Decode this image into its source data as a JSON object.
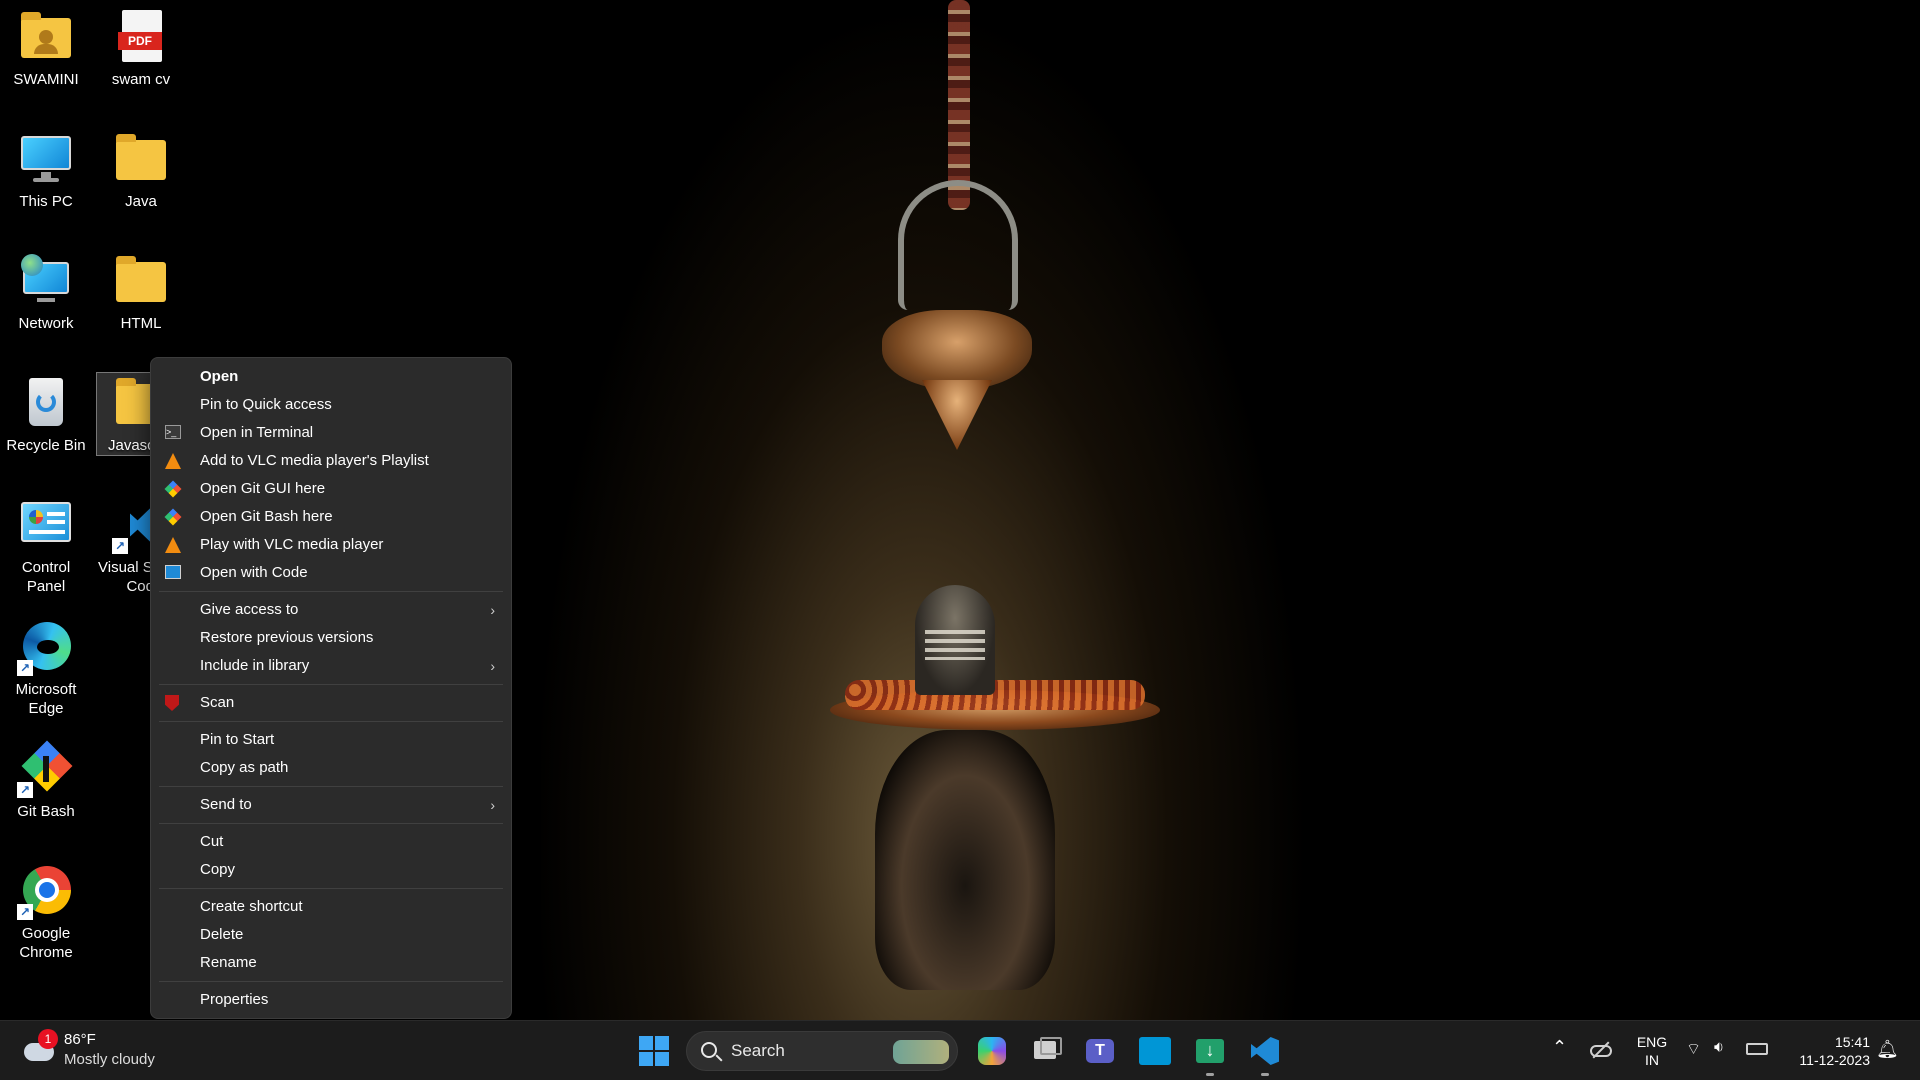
{
  "desktop_icons": [
    {
      "label": "SWAMINI",
      "icon": "user-folder-icon"
    },
    {
      "label": "swam cv",
      "icon": "pdf-file-icon",
      "badge": "PDF"
    },
    {
      "label": "This PC",
      "icon": "monitor-icon"
    },
    {
      "label": "Java",
      "icon": "folder-icon"
    },
    {
      "label": "Network",
      "icon": "network-icon"
    },
    {
      "label": "HTML",
      "icon": "folder-icon"
    },
    {
      "label": "Recycle Bin",
      "icon": "recycle-bin-icon"
    },
    {
      "label": "Javasc",
      "icon": "folder-icon"
    },
    {
      "label": "Control Panel",
      "icon": "control-panel-icon"
    },
    {
      "label": "Visual S",
      "label2": "Cod",
      "icon": "vscode-icon"
    },
    {
      "label": "Microsoft",
      "label2": "Edge",
      "icon": "edge-icon"
    },
    {
      "label": "Git Bash",
      "icon": "git-bash-icon"
    },
    {
      "label": "Google",
      "label2": "Chrome",
      "icon": "chrome-icon"
    }
  ],
  "context_menu": {
    "groups": [
      [
        {
          "label": "Open",
          "bold": true
        },
        {
          "label": "Pin to Quick access"
        },
        {
          "label": "Open in Terminal",
          "icon": "terminal-icon"
        },
        {
          "label": "Add to VLC media player's Playlist",
          "icon": "vlc-icon"
        },
        {
          "label": "Open Git GUI here",
          "icon": "git-icon"
        },
        {
          "label": "Open Git Bash here",
          "icon": "git-icon"
        },
        {
          "label": "Play with VLC media player",
          "icon": "vlc-icon"
        },
        {
          "label": "Open with Code",
          "icon": "vscode-icon"
        }
      ],
      [
        {
          "label": "Give access to",
          "submenu": true
        },
        {
          "label": "Restore previous versions"
        },
        {
          "label": "Include in library",
          "submenu": true
        }
      ],
      [
        {
          "label": "Scan",
          "icon": "mcafee-shield-icon"
        }
      ],
      [
        {
          "label": "Pin to Start"
        },
        {
          "label": "Copy as path"
        }
      ],
      [
        {
          "label": "Send to",
          "submenu": true
        }
      ],
      [
        {
          "label": "Cut"
        },
        {
          "label": "Copy"
        }
      ],
      [
        {
          "label": "Create shortcut"
        },
        {
          "label": "Delete"
        },
        {
          "label": "Rename"
        }
      ],
      [
        {
          "label": "Properties"
        }
      ]
    ]
  },
  "taskbar": {
    "weather": {
      "temp": "86°F",
      "condition": "Mostly cloudy",
      "badge": "1"
    },
    "search": {
      "label": "Search"
    },
    "apps": [
      "windows-start-icon",
      "copilot-icon",
      "task-view-icon",
      "teams-icon",
      "myhp-icon",
      "file-download-icon",
      "vscode-icon"
    ],
    "tray": {
      "language": "ENG",
      "region": "IN",
      "time": "15:41",
      "date": "11-12-2023"
    }
  },
  "colors": {
    "menu_bg": "#2b2b2b",
    "taskbar_bg": "#1c1c1c",
    "accent": "#0078d4"
  }
}
